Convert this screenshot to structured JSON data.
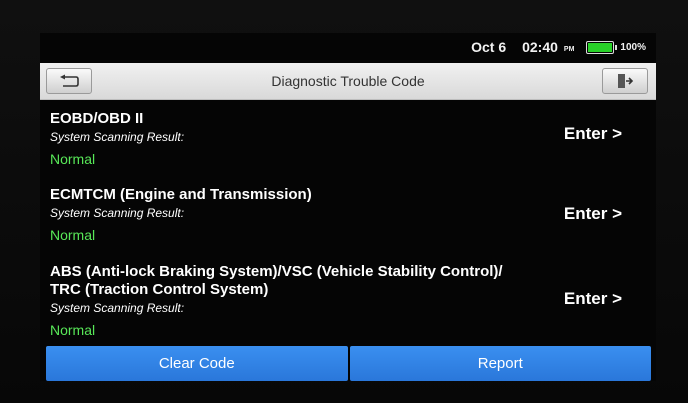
{
  "status_bar": {
    "date": "Oct 6",
    "time": "02:40",
    "ampm": "PM",
    "battery": "100%",
    "battery_level": 1.0
  },
  "header": {
    "title": "Diagnostic Trouble Code",
    "back_icon": "back-arrow-icon",
    "exit_icon": "exit-icon"
  },
  "systems": [
    {
      "name_lines": [
        "EOBD/OBD II"
      ],
      "scan_label": "System Scanning Result:",
      "status": "Normal",
      "enter": "Enter >"
    },
    {
      "name_lines": [
        "ECMTCM (Engine and Transmission)"
      ],
      "scan_label": "System Scanning Result:",
      "status": "Normal",
      "enter": "Enter >"
    },
    {
      "name_lines": [
        "ABS (Anti-lock Braking System)/VSC (Vehicle Stability Control)/",
        "TRC (Traction Control System)"
      ],
      "scan_label": "System Scanning Result:",
      "status": "Normal",
      "enter": "Enter >"
    }
  ],
  "bottom": {
    "clear_code": "Clear Code",
    "report": "Report"
  },
  "colors": {
    "accent_blue": "#2f82e6",
    "status_green": "#58e858",
    "header_bg": "#e4e4e4"
  }
}
